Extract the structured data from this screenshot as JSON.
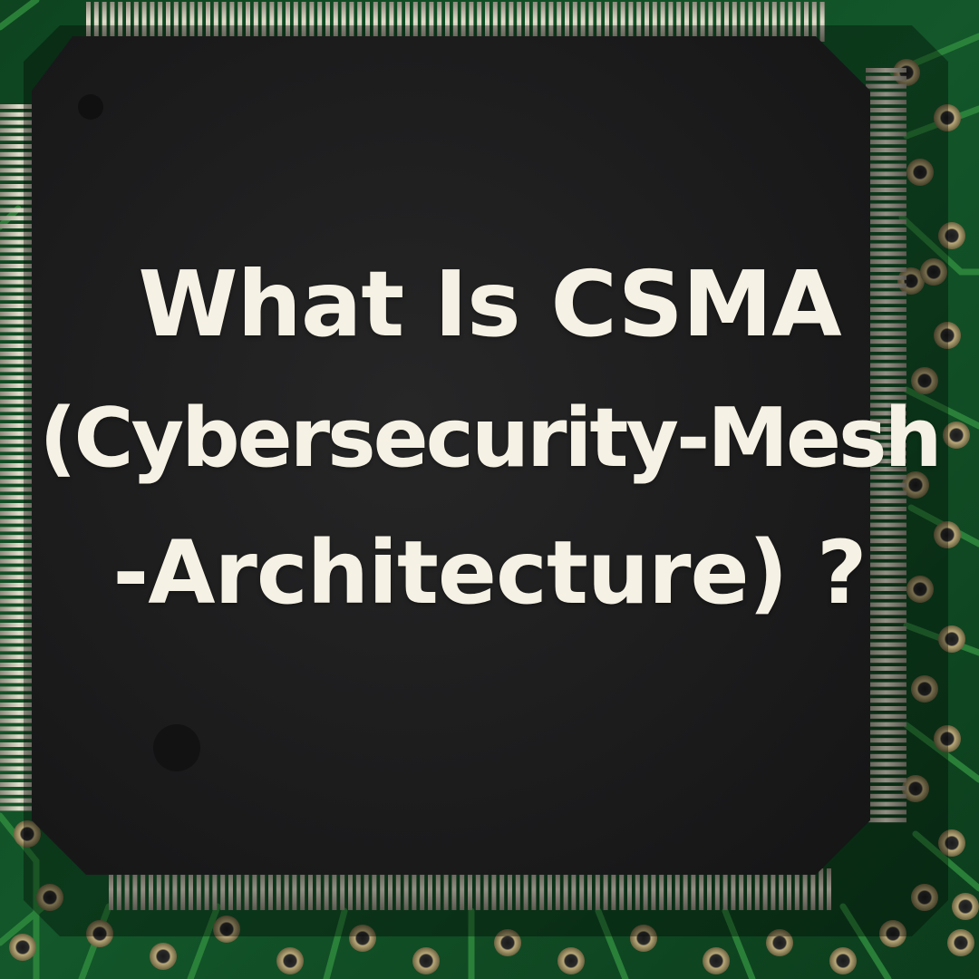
{
  "title": {
    "line1": "What Is CSMA",
    "line2": "(Cybersecurity-Mesh",
    "line3": "-Architecture) ?"
  },
  "colors": {
    "board": "#0f4a22",
    "trace": "#2f8a3d",
    "chip": "#1b1b1c",
    "pin": "#c9c2b0",
    "text": "#f5f1e4"
  }
}
